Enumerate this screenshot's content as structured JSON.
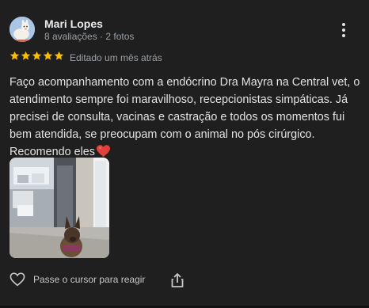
{
  "review": {
    "author": {
      "name": "Mari Lopes",
      "meta": "8 avaliações · 2 fotos",
      "avatar_icon": "llama-avatar"
    },
    "rating": 5,
    "rating_color": "#fbbc04",
    "edited": "Editado um mês atrás",
    "text": "Faço acompanhamento com a endócrino Dra Mayra na Central vet, o atendimento sempre foi maravilhoso, recepcionistas simpáticas. Já precisei de consulta, vacinas e castração e todos os momentos fui bem atendida, se preocupam com o animal no pós cirúrgico. Recomendo eles",
    "text_emoji": "heart-icon",
    "photo_icon": "review-photo-dog"
  },
  "actions": {
    "like_label": "Passe o cursor para reagir",
    "like_icon": "heart-outline-icon",
    "share_icon": "share-icon",
    "more_icon": "more-vert-icon"
  },
  "colors": {
    "background": "#1f1f1f",
    "text": "#e3e3e3",
    "secondary_text": "#9aa0a6"
  }
}
